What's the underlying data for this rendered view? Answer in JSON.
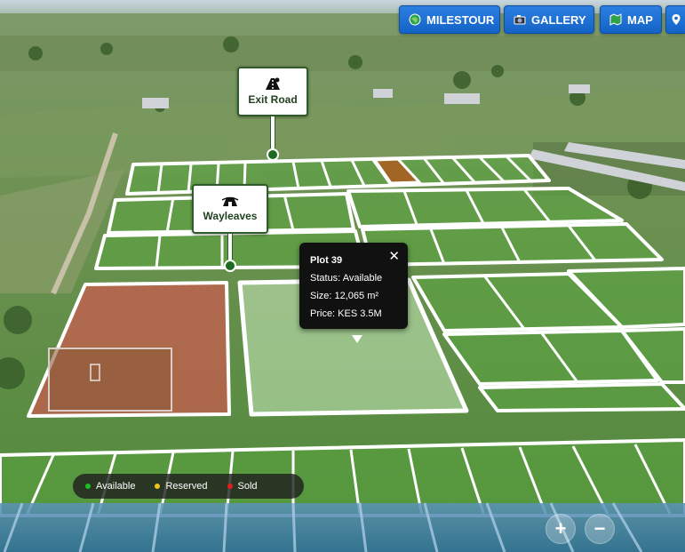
{
  "toolbar": {
    "milestour_label": "MILESTOUR",
    "gallery_label": "GALLERY",
    "map_label": "MAP"
  },
  "markers": {
    "exit_road_label": "Exit Road",
    "wayleaves_label": "Wayleaves"
  },
  "tooltip": {
    "title": "Plot 39",
    "status": "Status: Available",
    "size": "Size: 12,065 m²",
    "price": "Price: KES 3.5M",
    "close_glyph": "✕"
  },
  "legend": {
    "items": [
      {
        "label": "Available",
        "color": "#1ec21e"
      },
      {
        "label": "Reserved",
        "color": "#f0c419"
      },
      {
        "label": "Sold",
        "color": "#e02020"
      }
    ]
  },
  "zoom": {
    "in_label": "+",
    "out_label": "−"
  },
  "colors": {
    "accent_blue": "#1a6fd6",
    "sold_overlay": "#e25050",
    "reserved_overlay": "#b5541b",
    "selected_overlay": "#dfffd8",
    "plot_outline": "#ffffff"
  },
  "icons": {
    "milestour": "globe-icon",
    "gallery": "camera-icon",
    "map": "map-icon",
    "location": "location-pin-icon",
    "exit_road": "road-sign-icon",
    "wayleaves": "power-line-icon",
    "close": "close-icon"
  }
}
